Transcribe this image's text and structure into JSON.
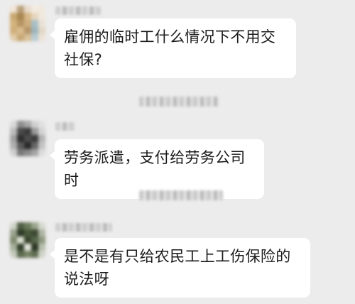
{
  "conversation": {
    "messages": [
      {
        "text": "雇佣的临时工什么情况下不用交社保?",
        "avatar": "blurred-avatar-1"
      },
      {
        "text": "劳务派遣，支付给劳务公司时",
        "avatar": "blurred-avatar-2"
      },
      {
        "text": "是不是有只给农民工上工伤保险的说法呀",
        "avatar": "blurred-avatar-3"
      }
    ]
  },
  "colors": {
    "background": "#ececec",
    "bubble": "#ffffff",
    "text": "#1b1b1b"
  }
}
